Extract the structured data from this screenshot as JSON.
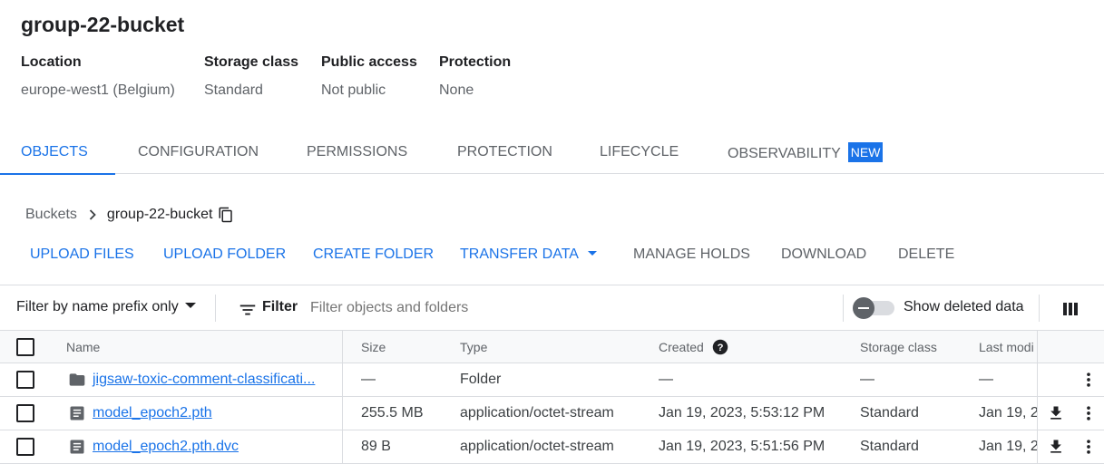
{
  "bucket": {
    "title": "group-22-bucket",
    "details": [
      {
        "label": "Location",
        "value": "europe-west1 (Belgium)"
      },
      {
        "label": "Storage class",
        "value": "Standard"
      },
      {
        "label": "Public access",
        "value": "Not public"
      },
      {
        "label": "Protection",
        "value": "None"
      }
    ]
  },
  "tabs": [
    {
      "label": "OBJECTS",
      "active": true
    },
    {
      "label": "CONFIGURATION"
    },
    {
      "label": "PERMISSIONS"
    },
    {
      "label": "PROTECTION"
    },
    {
      "label": "LIFECYCLE"
    },
    {
      "label": "OBSERVABILITY",
      "badge": "NEW"
    }
  ],
  "breadcrumb": {
    "root": "Buckets",
    "current": "group-22-bucket"
  },
  "actions": {
    "upload_files": "UPLOAD FILES",
    "upload_folder": "UPLOAD FOLDER",
    "create_folder": "CREATE FOLDER",
    "transfer_data": "TRANSFER DATA",
    "manage_holds": "MANAGE HOLDS",
    "download": "DOWNLOAD",
    "delete": "DELETE"
  },
  "filter": {
    "mode": "Filter by name prefix only",
    "label": "Filter",
    "placeholder": "Filter objects and folders",
    "show_deleted": "Show deleted data",
    "show_deleted_on": false
  },
  "table": {
    "columns": {
      "name": "Name",
      "size": "Size",
      "type": "Type",
      "created": "Created",
      "storage_class": "Storage class",
      "last_modified": "Last modi"
    },
    "rows": [
      {
        "icon": "folder-icon",
        "name": "jigsaw-toxic-comment-classificati...",
        "size": "—",
        "type": "Folder",
        "created": "—",
        "storage_class": "—",
        "last_modified": "—"
      },
      {
        "icon": "file-icon",
        "name": "model_epoch2.pth",
        "size": "255.5 MB",
        "type": "application/octet-stream",
        "created": "Jan 19, 2023, 5:53:12 PM",
        "storage_class": "Standard",
        "last_modified": "Jan 19, 2"
      },
      {
        "icon": "file-icon",
        "name": "model_epoch2.pth.dvc",
        "size": "89 B",
        "type": "application/octet-stream",
        "created": "Jan 19, 2023, 5:51:56 PM",
        "storage_class": "Standard",
        "last_modified": "Jan 19, 2"
      }
    ]
  },
  "colors": {
    "accent": "#1a73e8",
    "text": "#202124",
    "muted": "#5f6368",
    "border": "#dadce0"
  }
}
